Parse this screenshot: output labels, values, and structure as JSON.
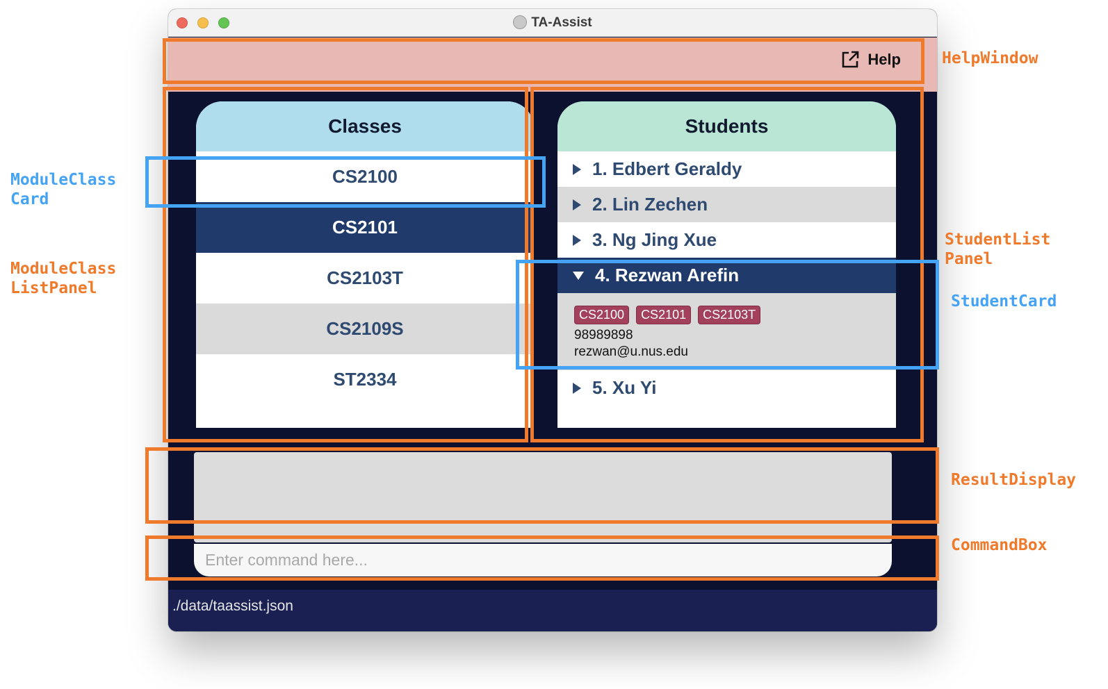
{
  "window": {
    "title": "TA-Assist"
  },
  "menu": {
    "help_label": "Help"
  },
  "classes_panel": {
    "header": "Classes",
    "items": [
      "CS2100",
      "CS2101",
      "CS2103T",
      "CS2109S",
      "ST2334"
    ],
    "selected": "CS2101"
  },
  "students_panel": {
    "header": "Students",
    "items": [
      {
        "label": "1. Edbert Geraldy",
        "expanded": false
      },
      {
        "label": "2. Lin Zechen",
        "expanded": false
      },
      {
        "label": "3. Ng Jing Xue",
        "expanded": false
      },
      {
        "label": "4. Rezwan Arefin",
        "expanded": true,
        "tags": [
          "CS2100",
          "CS2101",
          "CS2103T"
        ],
        "phone": "98989898",
        "email": "rezwan@u.nus.edu"
      },
      {
        "label": "5. Xu Yi",
        "expanded": false
      }
    ]
  },
  "command_box": {
    "placeholder": "Enter command here..."
  },
  "status_bar": {
    "path": "./data/taassist.json"
  },
  "annotations": {
    "help_window": "HelpWindow",
    "module_class_card": "ModuleClass\nCard",
    "module_class_list_panel": "ModuleClass\nListPanel",
    "student_list_panel": "StudentList\nPanel",
    "student_card": "StudentCard",
    "result_display": "ResultDisplay",
    "command_box": "CommandBox"
  },
  "colors": {
    "annotation_orange": "#ef7a2b",
    "annotation_blue": "#45a3f5",
    "window_bg": "#0c1130",
    "menubar_bg": "#e8b8b5",
    "classes_header": "#b0ddee",
    "students_header": "#b9e6d5",
    "selected_row": "#1f3a6b",
    "tag_bg": "#a3405c"
  }
}
